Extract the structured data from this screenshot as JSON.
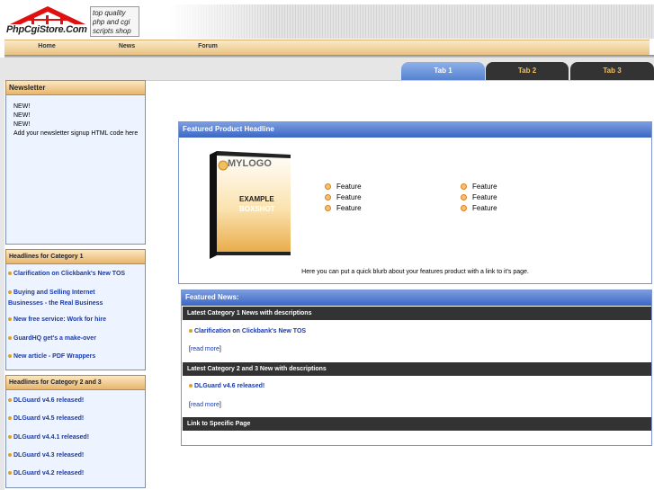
{
  "header": {
    "logo_text": "PhpCgiStore.Com",
    "tagline": [
      "top quality",
      "php and cgi",
      "scripts shop"
    ]
  },
  "nav": {
    "items": [
      {
        "label": "Home"
      },
      {
        "label": "News"
      },
      {
        "label": "Forum"
      }
    ]
  },
  "tabs": [
    {
      "label": "Tab 1",
      "active": true
    },
    {
      "label": "Tab 2",
      "active": false
    },
    {
      "label": "Tab 3",
      "active": false
    }
  ],
  "sidebar": {
    "newsletter": {
      "title": "Newsletter",
      "lines": [
        "NEW!",
        "NEW!",
        "NEW!",
        "Add your newsletter signup HTML code here"
      ]
    },
    "category1": {
      "title": "Headlines for Category 1",
      "items": [
        "Clarification on Clickbank's New TOS",
        "Buying and Selling Internet Businesses - the Real Business",
        "New free service: Work for hire",
        "GuardHQ get's a make-over",
        "New article - PDF Wrappers"
      ]
    },
    "category23": {
      "title": "Headlines for Category 2 and 3",
      "items": [
        "DLGuard v4.6 released!",
        "DLGuard v4.5 released!",
        "DLGuard v4.4.1 released!",
        "DLGuard v4.3 released!",
        "DLGuard v4.2 released!"
      ]
    }
  },
  "featured_product": {
    "headline": "Featured Product Headline",
    "box_logo": "MYLOGO",
    "box_line1": "EXAMPLE",
    "box_line2": "BOXSHOT",
    "features_col1": [
      "Feature",
      "Feature",
      "Feature"
    ],
    "features_col2": [
      "Feature",
      "Feature",
      "Feature"
    ],
    "blurb": "Here you can put a quick blurb about your features product with a link to it's page."
  },
  "featured_news": {
    "title": "Featured News:",
    "section1": {
      "title": "Latest Category 1 News with descriptions",
      "link": "Clarification on Clickbank's New TOS",
      "read_more": "read more"
    },
    "section2": {
      "title": "Latest Category 2 and 3 New with descriptions",
      "link": "DLGuard v4.6 released!",
      "read_more": "read more"
    },
    "section3": {
      "title": "Link to Specific Page"
    }
  },
  "colors": {
    "link": "#1a3aa8",
    "tab_active": "#6b93d6",
    "tab_inactive": "#333333",
    "nav_gradient_top": "#fbe9c8",
    "nav_gradient_bottom": "#e9c282",
    "panel_head": "#3b66c6"
  }
}
